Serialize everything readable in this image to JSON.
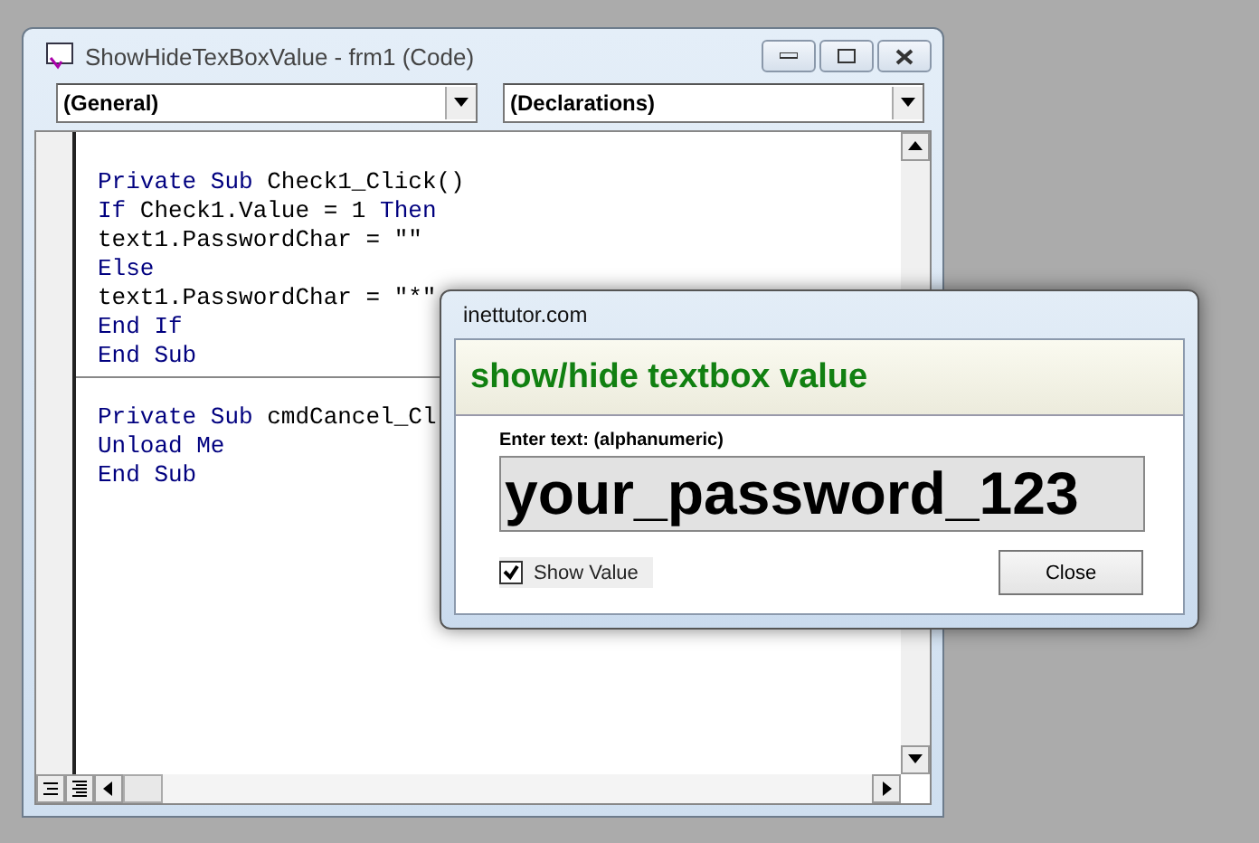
{
  "window": {
    "title": "ShowHideTexBoxValue - frm1 (Code)"
  },
  "object_combo": {
    "value": "(General)"
  },
  "procedure_combo": {
    "value": "(Declarations)"
  },
  "code": {
    "procedures": [
      {
        "lines": [
          [
            {
              "text": "Private Sub",
              "kind": "keyword"
            },
            {
              "text": " Check1_Click()",
              "kind": "plain"
            }
          ],
          [
            {
              "text": "If",
              "kind": "keyword"
            },
            {
              "text": " Check1.Value = 1 ",
              "kind": "plain"
            },
            {
              "text": "Then",
              "kind": "keyword"
            }
          ],
          [
            {
              "text": "text1.PasswordChar = \"\"",
              "kind": "plain"
            }
          ],
          [
            {
              "text": "Else",
              "kind": "keyword"
            }
          ],
          [
            {
              "text": "text1.PasswordChar = \"*\"",
              "kind": "plain"
            }
          ],
          [
            {
              "text": "End If",
              "kind": "keyword"
            }
          ],
          [
            {
              "text": "End Sub",
              "kind": "keyword"
            }
          ]
        ]
      },
      {
        "lines": [
          [
            {
              "text": "Private Sub",
              "kind": "keyword"
            },
            {
              "text": " cmdCancel_Cl",
              "kind": "plain"
            }
          ],
          [
            {
              "text": "Unload Me",
              "kind": "keyword"
            }
          ],
          [
            {
              "text": "End Sub",
              "kind": "keyword"
            }
          ]
        ]
      }
    ]
  },
  "dialog": {
    "title": "inettutor.com",
    "heading": "show/hide textbox value",
    "field_label": "Enter text: (alphanumeric)",
    "field_value": "your_password_123",
    "checkbox": {
      "label": "Show Value",
      "checked": true
    },
    "close_button": "Close"
  }
}
